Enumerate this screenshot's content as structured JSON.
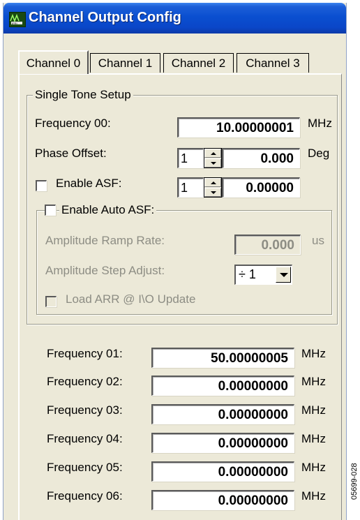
{
  "window": {
    "title": "Channel Output Config",
    "icon": "app-logo-icon"
  },
  "tabs": [
    {
      "label": "Channel 0",
      "active": true
    },
    {
      "label": "Channel 1",
      "active": false
    },
    {
      "label": "Channel 2",
      "active": false
    },
    {
      "label": "Channel 3",
      "active": false
    }
  ],
  "single_tone": {
    "group_label": "Single Tone Setup",
    "frequency00": {
      "label": "Frequency 00:",
      "value": "10.00000001",
      "unit": "MHz"
    },
    "phase_offset": {
      "label": "Phase Offset:",
      "step": "1",
      "value": "0.000",
      "unit": "Deg"
    },
    "enable_asf": {
      "label": "Enable ASF:",
      "checked": false,
      "step": "1",
      "value": "0.00000"
    },
    "auto_asf": {
      "label": "Enable Auto ASF:",
      "checked": false,
      "ramp_rate": {
        "label": "Amplitude Ramp Rate:",
        "value": "0.000",
        "unit": "us"
      },
      "step_adjust": {
        "label": "Amplitude Step Adjust:",
        "selected": "÷ 1"
      },
      "load_arr": {
        "label": "Load ARR @ I\\O Update",
        "checked": false
      }
    }
  },
  "frequencies": [
    {
      "label": "Frequency 01:",
      "value": "50.00000005",
      "unit": "MHz"
    },
    {
      "label": "Frequency 02:",
      "value": "0.00000000",
      "unit": "MHz"
    },
    {
      "label": "Frequency 03:",
      "value": "0.00000000",
      "unit": "MHz"
    },
    {
      "label": "Frequency 04:",
      "value": "0.00000000",
      "unit": "MHz"
    },
    {
      "label": "Frequency 05:",
      "value": "0.00000000",
      "unit": "MHz"
    },
    {
      "label": "Frequency 06:",
      "value": "0.00000000",
      "unit": "MHz"
    }
  ],
  "figure_code": "05699-028",
  "colors": {
    "titlebar": "#0a4fd0",
    "window_bg": "#ece9d8",
    "disabled_text": "#8d8d84"
  }
}
